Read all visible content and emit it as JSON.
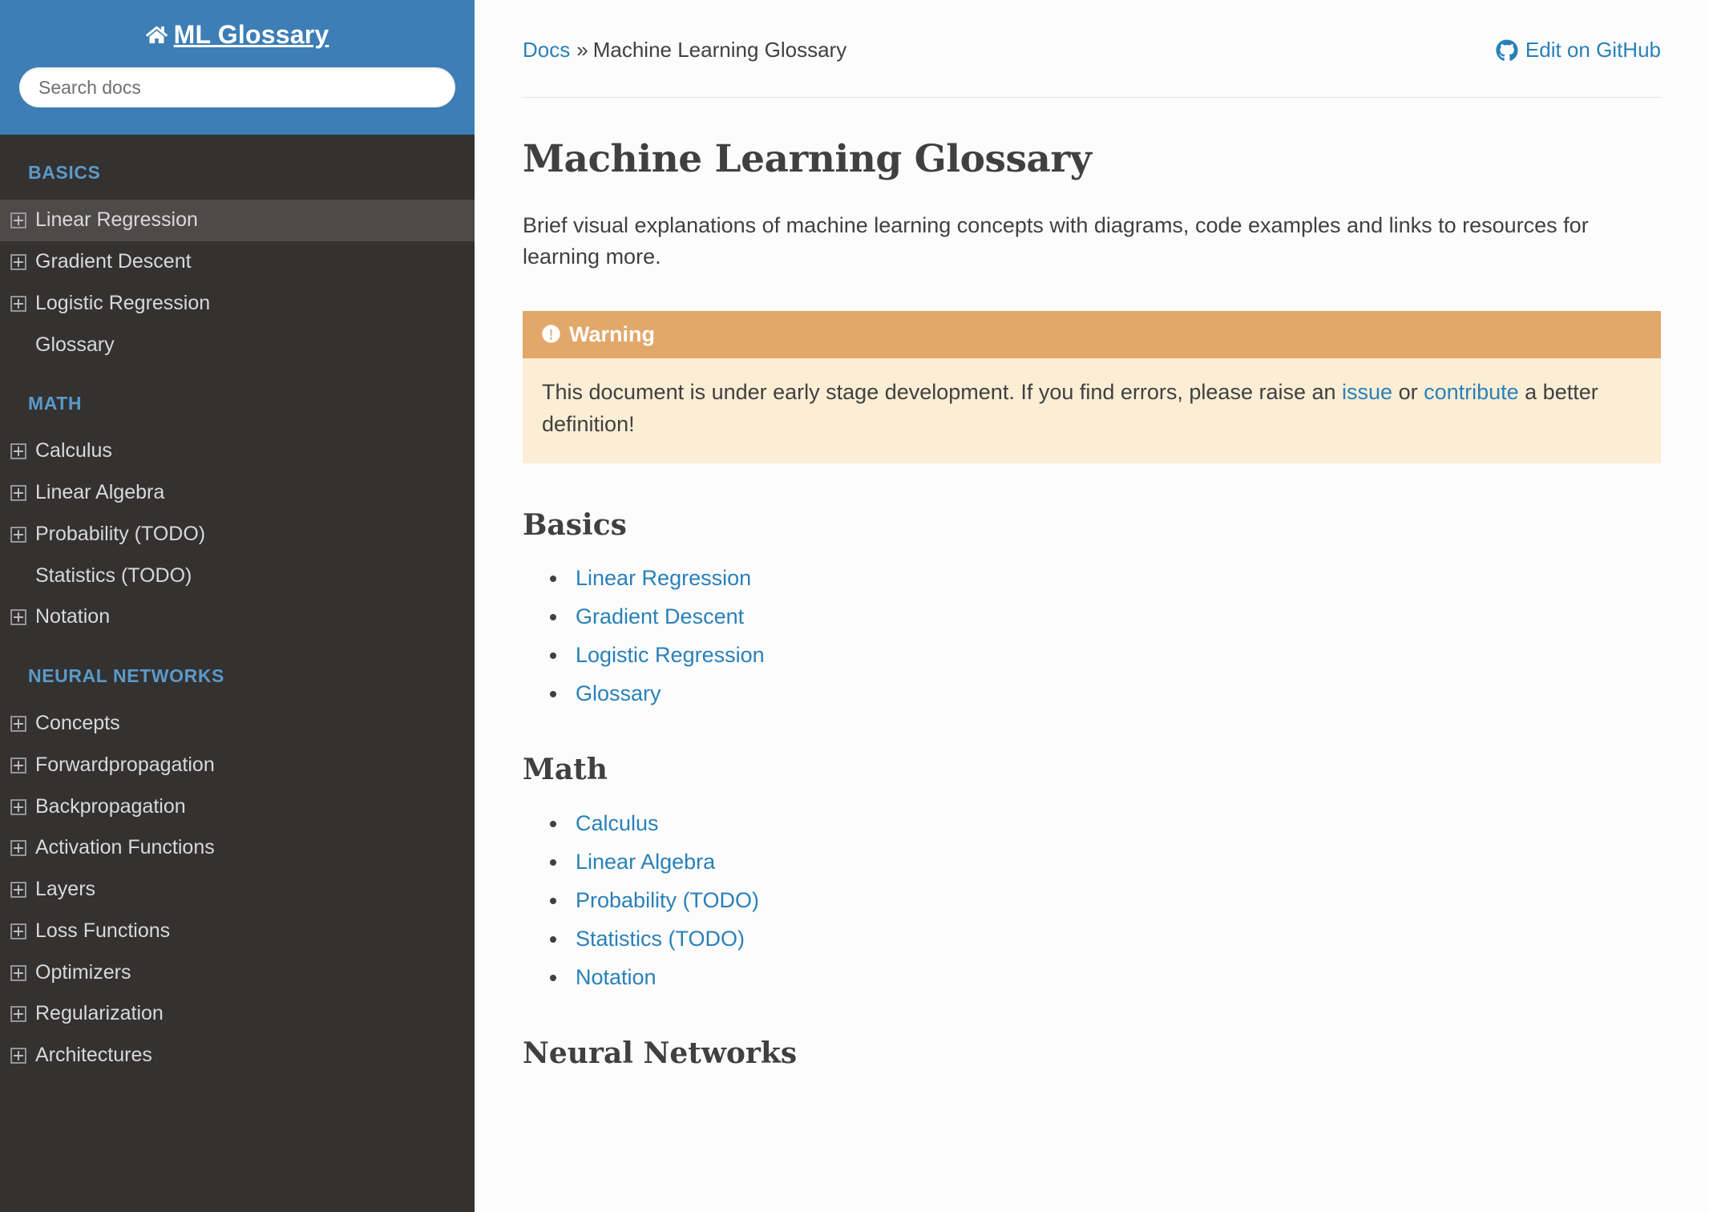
{
  "sidebar": {
    "brand": "ML Glossary",
    "home_icon": "home-icon",
    "search": {
      "placeholder": "Search docs",
      "value": ""
    },
    "sections": [
      {
        "caption": "Basics",
        "items": [
          {
            "label": "Linear Regression",
            "expandable": true,
            "current": true
          },
          {
            "label": "Gradient Descent",
            "expandable": true,
            "current": false
          },
          {
            "label": "Logistic Regression",
            "expandable": true,
            "current": false
          },
          {
            "label": "Glossary",
            "expandable": false,
            "current": false
          }
        ]
      },
      {
        "caption": "Math",
        "items": [
          {
            "label": "Calculus",
            "expandable": true,
            "current": false
          },
          {
            "label": "Linear Algebra",
            "expandable": true,
            "current": false
          },
          {
            "label": "Probability (TODO)",
            "expandable": true,
            "current": false
          },
          {
            "label": "Statistics (TODO)",
            "expandable": false,
            "current": false
          },
          {
            "label": "Notation",
            "expandable": true,
            "current": false
          }
        ]
      },
      {
        "caption": "Neural Networks",
        "items": [
          {
            "label": "Concepts",
            "expandable": true,
            "current": false
          },
          {
            "label": "Forwardpropagation",
            "expandable": true,
            "current": false
          },
          {
            "label": "Backpropagation",
            "expandable": true,
            "current": false
          },
          {
            "label": "Activation Functions",
            "expandable": true,
            "current": false
          },
          {
            "label": "Layers",
            "expandable": true,
            "current": false
          },
          {
            "label": "Loss Functions",
            "expandable": true,
            "current": false
          },
          {
            "label": "Optimizers",
            "expandable": true,
            "current": false
          },
          {
            "label": "Regularization",
            "expandable": true,
            "current": false
          },
          {
            "label": "Architectures",
            "expandable": true,
            "current": false
          }
        ]
      }
    ]
  },
  "header": {
    "breadcrumb_root": "Docs",
    "breadcrumb_separator": "»",
    "breadcrumb_current": "Machine Learning Glossary",
    "edit_link_label": "Edit on GitHub",
    "edit_link_icon": "github-icon"
  },
  "main": {
    "title": "Machine Learning Glossary",
    "intro": "Brief visual explanations of machine learning concepts with diagrams, code examples and links to resources for learning more.",
    "warning": {
      "icon": "exclamation-circle-icon",
      "title": "Warning",
      "text_part1": "This document is under early stage development. If you find errors, please raise an ",
      "link1": "issue",
      "text_part2": " or ",
      "link2": "contribute",
      "text_part3": " a better definition!"
    },
    "sections": [
      {
        "heading": "Basics",
        "links": [
          "Linear Regression",
          "Gradient Descent",
          "Logistic Regression",
          "Glossary"
        ]
      },
      {
        "heading": "Math",
        "links": [
          "Calculus",
          "Linear Algebra",
          "Probability (TODO)",
          "Statistics (TODO)",
          "Notation"
        ]
      },
      {
        "heading": "Neural Networks",
        "links": []
      }
    ]
  },
  "colors": {
    "sidebar_header_blue": "#3c7eb5",
    "sidebar_dark": "#343131",
    "sidebar_current": "#4e4a4a",
    "caption_blue": "#5a9ac9",
    "link_blue": "#2980b9",
    "warning_header": "#e2a86a",
    "warning_body": "#fbeed5",
    "text_dark": "#404040"
  }
}
